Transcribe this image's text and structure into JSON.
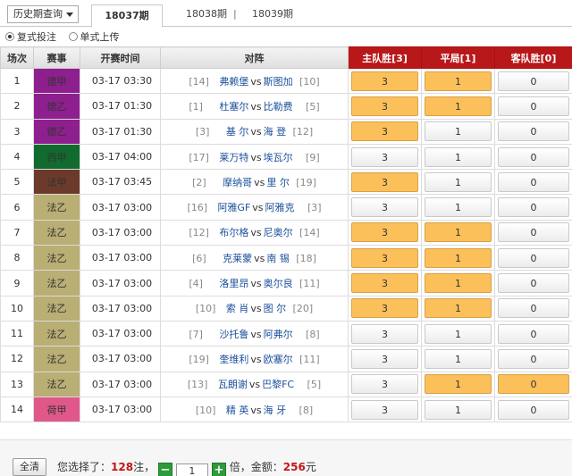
{
  "topbar": {
    "history_select": "历史期查询",
    "tabs": [
      {
        "label": "18037期",
        "active": true
      },
      {
        "label": "18038期",
        "active": false
      },
      {
        "label": "18039期",
        "active": false
      }
    ],
    "separator": "|"
  },
  "mode": {
    "options": [
      {
        "label": "复式投注",
        "selected": true
      },
      {
        "label": "单式上传",
        "selected": false
      }
    ]
  },
  "table": {
    "headers": {
      "num": "场次",
      "league": "赛事",
      "time": "开赛时间",
      "match": "对阵",
      "home": "主队胜[3]",
      "draw": "平局[1]",
      "away": "客队胜[0]"
    },
    "vs": "vs",
    "rows": [
      {
        "num": "1",
        "league": "德甲",
        "league_color": "#8e1f8e",
        "time": "03-17 03:30",
        "home_rank": "[14]",
        "home": "弗赖堡",
        "away": "斯图加",
        "away_rank": "[10]",
        "b3": "3",
        "b1": "1",
        "b0": "0",
        "s3": true,
        "s1": true,
        "s0": false
      },
      {
        "num": "2",
        "league": "德乙",
        "league_color": "#8e1f8e",
        "time": "03-17 01:30",
        "home_rank": "[1]",
        "home": "杜塞尔",
        "away": "比勒费",
        "away_rank": "[5]",
        "b3": "3",
        "b1": "1",
        "b0": "0",
        "s3": true,
        "s1": true,
        "s0": false
      },
      {
        "num": "3",
        "league": "德乙",
        "league_color": "#8e1f8e",
        "time": "03-17 01:30",
        "home_rank": "[3]",
        "home": "基 尔",
        "away": "海 登",
        "away_rank": "[12]",
        "b3": "3",
        "b1": "1",
        "b0": "0",
        "s3": true,
        "s1": false,
        "s0": false
      },
      {
        "num": "4",
        "league": "西甲",
        "league_color": "#116b2e",
        "time": "03-17 04:00",
        "home_rank": "[17]",
        "home": "莱万特",
        "away": "埃瓦尔",
        "away_rank": "[9]",
        "b3": "3",
        "b1": "1",
        "b0": "0",
        "s3": false,
        "s1": false,
        "s0": false
      },
      {
        "num": "5",
        "league": "法甲",
        "league_color": "#6b3a2a",
        "time": "03-17 03:45",
        "home_rank": "[2]",
        "home": "摩纳哥",
        "away": "里 尔",
        "away_rank": "[19]",
        "b3": "3",
        "b1": "1",
        "b0": "0",
        "s3": true,
        "s1": false,
        "s0": false
      },
      {
        "num": "6",
        "league": "法乙",
        "league_color": "#b9ae73",
        "time": "03-17 03:00",
        "home_rank": "[16]",
        "home": "阿雅GF",
        "away": "阿雅克",
        "away_rank": "[3]",
        "b3": "3",
        "b1": "1",
        "b0": "0",
        "s3": false,
        "s1": false,
        "s0": false
      },
      {
        "num": "7",
        "league": "法乙",
        "league_color": "#b9ae73",
        "time": "03-17 03:00",
        "home_rank": "[12]",
        "home": "布尔格",
        "away": "尼奥尔",
        "away_rank": "[14]",
        "b3": "3",
        "b1": "1",
        "b0": "0",
        "s3": true,
        "s1": true,
        "s0": false
      },
      {
        "num": "8",
        "league": "法乙",
        "league_color": "#b9ae73",
        "time": "03-17 03:00",
        "home_rank": "[6]",
        "home": "克莱蒙",
        "away": "南 锡",
        "away_rank": "[18]",
        "b3": "3",
        "b1": "1",
        "b0": "0",
        "s3": true,
        "s1": true,
        "s0": false
      },
      {
        "num": "9",
        "league": "法乙",
        "league_color": "#b9ae73",
        "time": "03-17 03:00",
        "home_rank": "[4]",
        "home": "洛里昂",
        "away": "奥尔良",
        "away_rank": "[11]",
        "b3": "3",
        "b1": "1",
        "b0": "0",
        "s3": true,
        "s1": true,
        "s0": false
      },
      {
        "num": "10",
        "league": "法乙",
        "league_color": "#b9ae73",
        "time": "03-17 03:00",
        "home_rank": "[10]",
        "home": "索 肖",
        "away": "图 尔",
        "away_rank": "[20]",
        "b3": "3",
        "b1": "1",
        "b0": "0",
        "s3": true,
        "s1": true,
        "s0": false
      },
      {
        "num": "11",
        "league": "法乙",
        "league_color": "#b9ae73",
        "time": "03-17 03:00",
        "home_rank": "[7]",
        "home": "沙托鲁",
        "away": "阿弗尔",
        "away_rank": "[8]",
        "b3": "3",
        "b1": "1",
        "b0": "0",
        "s3": false,
        "s1": false,
        "s0": false
      },
      {
        "num": "12",
        "league": "法乙",
        "league_color": "#b9ae73",
        "time": "03-17 03:00",
        "home_rank": "[19]",
        "home": "奎维利",
        "away": "欧塞尔",
        "away_rank": "[11]",
        "b3": "3",
        "b1": "1",
        "b0": "0",
        "s3": false,
        "s1": false,
        "s0": false
      },
      {
        "num": "13",
        "league": "法乙",
        "league_color": "#b9ae73",
        "time": "03-17 03:00",
        "home_rank": "[13]",
        "home": "瓦朗谢",
        "away": "巴黎FC",
        "away_rank": "[5]",
        "b3": "3",
        "b1": "1",
        "b0": "0",
        "s3": false,
        "s1": true,
        "s0": true
      },
      {
        "num": "14",
        "league": "荷甲",
        "league_color": "#e0588a",
        "time": "03-17 03:00",
        "home_rank": "[10]",
        "home": "精 英",
        "away": "海 牙",
        "away_rank": "[8]",
        "b3": "3",
        "b1": "1",
        "b0": "0",
        "s3": false,
        "s1": false,
        "s0": false
      }
    ]
  },
  "footer": {
    "clear_label": "全清",
    "selected_prefix": "您选择了：",
    "bets_count": "128",
    "bets_unit": "注，",
    "minus": "−",
    "multiplier": "1",
    "plus": "+",
    "mult_unit": "倍，金额：",
    "amount": "256",
    "amount_unit": "元"
  }
}
